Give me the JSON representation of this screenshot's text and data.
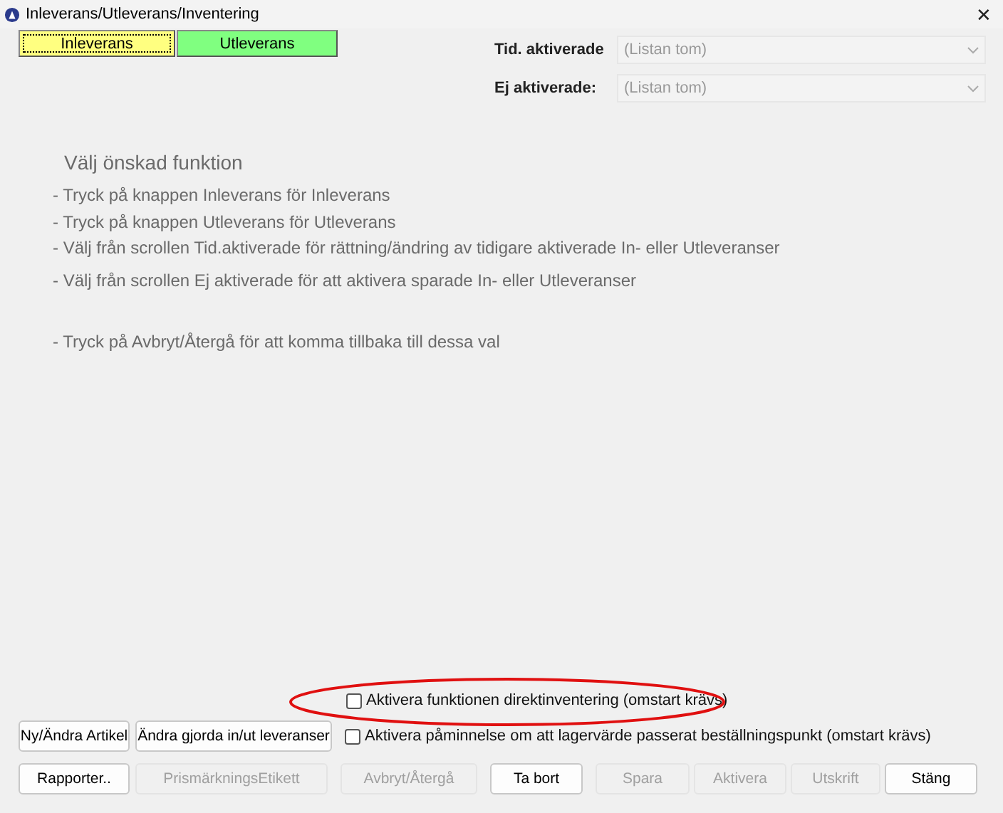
{
  "window": {
    "title": "Inleverans/Utleverans/Inventering",
    "close": "✕"
  },
  "tabs": [
    {
      "label": "Inleverans",
      "color": "#ffff80",
      "selected": true
    },
    {
      "label": "Utleverans",
      "color": "#80ff80",
      "selected": false
    }
  ],
  "lists": [
    {
      "label": "Tid. aktiverade",
      "value": "(Listan tom)"
    },
    {
      "label": "Ej aktiverade:",
      "value": "(Listan tom)"
    }
  ],
  "instructions": {
    "heading": "Välj önskad funktion",
    "lines": [
      "- Tryck på knappen Inleverans för Inleverans",
      "- Tryck på knappen Utleverans för Utleverans",
      "- Välj från scrollen Tid.aktiverade för rättning/ändring av tidigare aktiverade In- eller Utleveranser",
      "- Välj från scrollen Ej aktiverade för att aktivera sparade In- eller Utleveranser",
      "- Tryck på Avbryt/Återgå för att komma tillbaka till dessa val"
    ]
  },
  "checkboxes": [
    {
      "label": "Aktivera funktionen direktinventering (omstart krävs)",
      "checked": false,
      "highlighted": true
    },
    {
      "label": "Aktivera påminnelse om att lagervärde passerat beställningspunkt (omstart krävs)",
      "checked": false,
      "highlighted": false
    }
  ],
  "article_buttons": [
    {
      "label": "Ny/Ändra Artikel",
      "disabled": false
    },
    {
      "label": "Ändra gjorda in/ut leveranser",
      "disabled": false
    }
  ],
  "action_buttons": [
    {
      "label": "Rapporter..",
      "disabled": false
    },
    {
      "label": "PrismärkningsEtikett",
      "disabled": true
    },
    {
      "label": "Avbryt/Återgå",
      "disabled": true
    },
    {
      "label": "Ta bort",
      "disabled": false
    },
    {
      "label": "Spara",
      "disabled": true
    },
    {
      "label": "Aktivera",
      "disabled": true
    },
    {
      "label": "Utskrift",
      "disabled": true
    },
    {
      "label": "Stäng",
      "disabled": false
    }
  ]
}
